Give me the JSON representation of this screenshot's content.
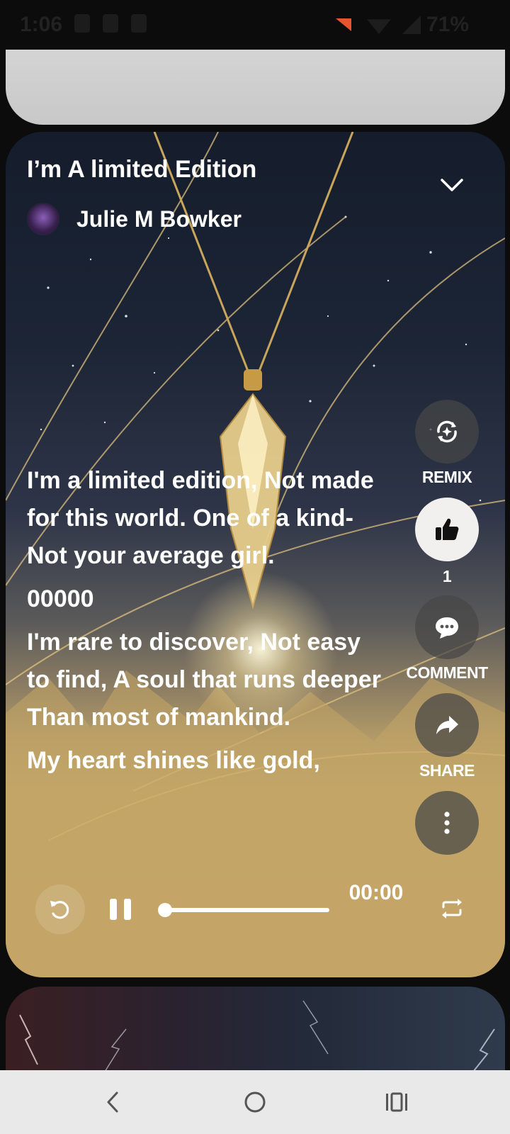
{
  "status_bar": {
    "time": "1:06",
    "battery": "71%"
  },
  "song": {
    "title": "I’m A limited Edition",
    "artist": "Julie M Bowker"
  },
  "lyrics": [
    "I'm a limited edition, Not made for this world. One of a kind-Not your average girl.",
    "00000",
    "I'm rare to discover, Not easy to find, A soul that runs deeper Than most of mankind.",
    "My heart shines like gold,"
  ],
  "actions": {
    "remix_label": "REMIX",
    "like_count": "1",
    "comment_label": "COMMENT",
    "share_label": "SHARE"
  },
  "player": {
    "time": "00:00",
    "progress": 0.0
  },
  "icons": {
    "collapse": "chevron-down-icon",
    "remix": "remix-sparkle-icon",
    "like": "thumbs-up-icon",
    "comment": "comment-bubble-icon",
    "share": "share-arrow-icon",
    "more": "more-vertical-icon",
    "restart": "restart-icon",
    "pause": "pause-icon",
    "repeat": "repeat-icon",
    "back": "back-icon",
    "home": "home-icon",
    "recents": "recents-icon"
  },
  "colors": {
    "accent_gold": "#c8a96a",
    "like_bg": "#f2f0ee"
  }
}
